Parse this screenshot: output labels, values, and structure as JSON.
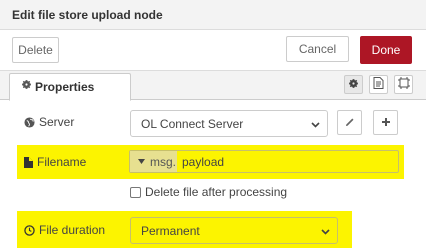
{
  "dialog": {
    "title": "Edit file store upload node",
    "delete_label": "Delete",
    "cancel_label": "Cancel",
    "done_label": "Done"
  },
  "tabs": [
    {
      "label": "Properties",
      "icon": "gear-icon",
      "active": true
    }
  ],
  "tab_icons": [
    "gear-icon",
    "description-icon",
    "appearance-icon"
  ],
  "form": {
    "server": {
      "label": "Server",
      "icon": "globe-icon",
      "value": "OL Connect Server",
      "edit_icon": "pencil-icon",
      "add_icon": "plus-icon"
    },
    "filename": {
      "label": "Filename",
      "icon": "file-icon",
      "type_prefix": "msg.",
      "value": "payload"
    },
    "delete_after": {
      "label": "Delete file after processing",
      "checked": false
    },
    "file_duration": {
      "label": "File duration",
      "icon": "clock-icon",
      "value": "Permanent"
    }
  },
  "colors": {
    "highlight": "#fcf400",
    "done_button": "#ad1625"
  }
}
